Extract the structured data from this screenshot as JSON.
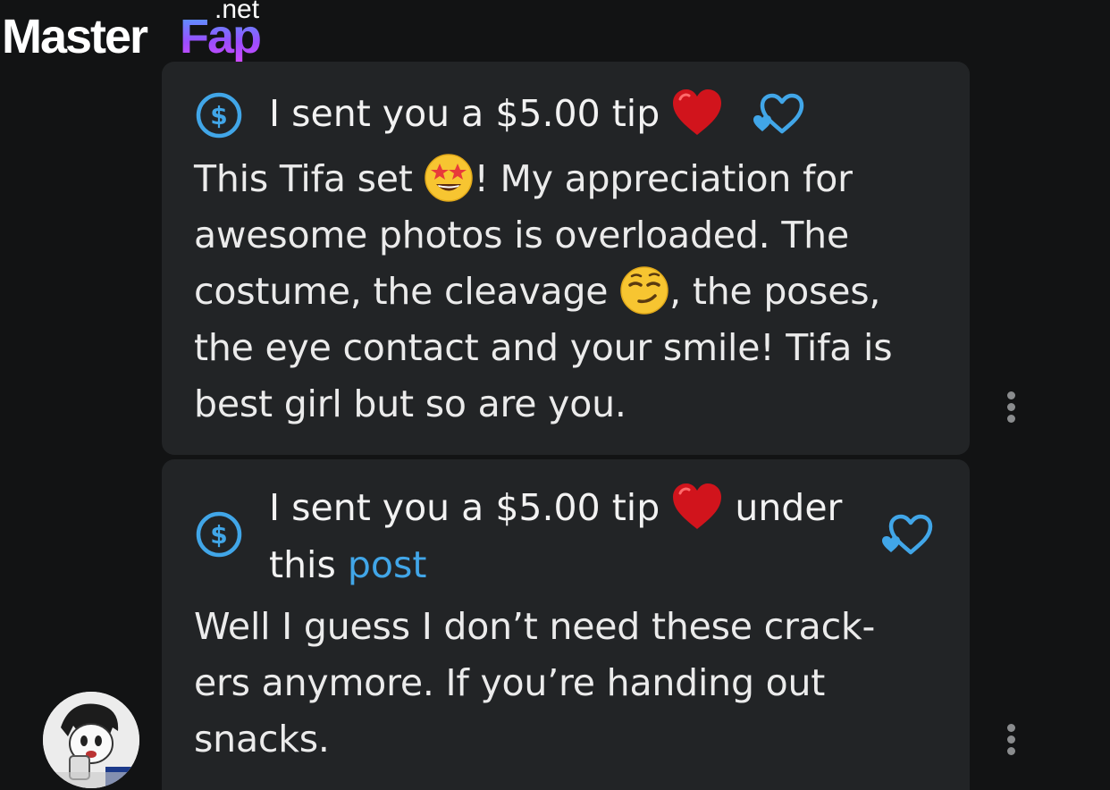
{
  "watermark": {
    "brand_master": "Master",
    "brand_fap": "Fap",
    "brand_tld": ".net"
  },
  "messages": [
    {
      "tip_title_prefix": "I sent you a $5.00 tip",
      "tip_title_suffix": "",
      "tip_link": "",
      "body_parts": [
        "This Tifa set ",
        "! My appreciation for awesome photos is overloaded. The costume, the cleavage ",
        ", the poses, the eye contact and your smile! Tifa is best girl but so are you."
      ]
    },
    {
      "tip_title_prefix": "I sent you a $5.00 tip",
      "tip_title_suffix": "under",
      "tip_title_line2": "this",
      "tip_link": "post",
      "body": "Well I guess I don’t need these crack-ers anymore. If you’re handing out snacks."
    }
  ],
  "colors": {
    "background": "#121314",
    "bubble": "#222426",
    "accent": "#41a6e8",
    "heart": "#d1141c"
  },
  "icons": {
    "tip": "dollar-circle-icon",
    "heart": "red-heart-icon",
    "react": "heart-outline-icon",
    "menu": "more-vertical-icon",
    "emoji_1": "star-struck-emoji",
    "emoji_2": "smirk-emoji"
  }
}
